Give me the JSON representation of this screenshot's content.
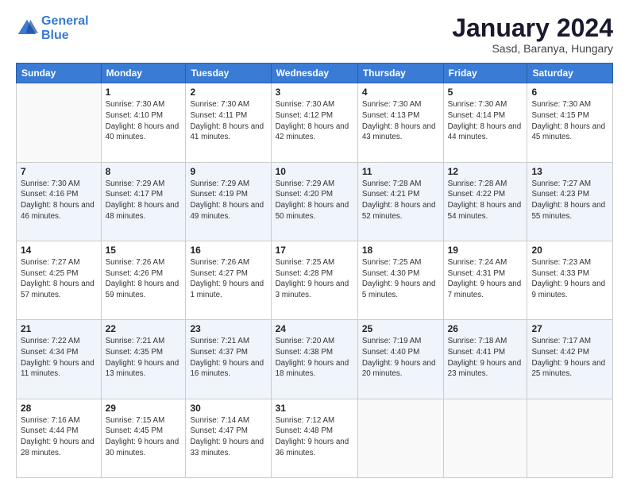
{
  "header": {
    "logo_line1": "General",
    "logo_line2": "Blue",
    "title": "January 2024",
    "subtitle": "Sasd, Baranya, Hungary"
  },
  "days_of_week": [
    "Sunday",
    "Monday",
    "Tuesday",
    "Wednesday",
    "Thursday",
    "Friday",
    "Saturday"
  ],
  "weeks": [
    [
      {
        "num": "",
        "sunrise": "",
        "sunset": "",
        "daylight": ""
      },
      {
        "num": "1",
        "sunrise": "Sunrise: 7:30 AM",
        "sunset": "Sunset: 4:10 PM",
        "daylight": "Daylight: 8 hours and 40 minutes."
      },
      {
        "num": "2",
        "sunrise": "Sunrise: 7:30 AM",
        "sunset": "Sunset: 4:11 PM",
        "daylight": "Daylight: 8 hours and 41 minutes."
      },
      {
        "num": "3",
        "sunrise": "Sunrise: 7:30 AM",
        "sunset": "Sunset: 4:12 PM",
        "daylight": "Daylight: 8 hours and 42 minutes."
      },
      {
        "num": "4",
        "sunrise": "Sunrise: 7:30 AM",
        "sunset": "Sunset: 4:13 PM",
        "daylight": "Daylight: 8 hours and 43 minutes."
      },
      {
        "num": "5",
        "sunrise": "Sunrise: 7:30 AM",
        "sunset": "Sunset: 4:14 PM",
        "daylight": "Daylight: 8 hours and 44 minutes."
      },
      {
        "num": "6",
        "sunrise": "Sunrise: 7:30 AM",
        "sunset": "Sunset: 4:15 PM",
        "daylight": "Daylight: 8 hours and 45 minutes."
      }
    ],
    [
      {
        "num": "7",
        "sunrise": "Sunrise: 7:30 AM",
        "sunset": "Sunset: 4:16 PM",
        "daylight": "Daylight: 8 hours and 46 minutes."
      },
      {
        "num": "8",
        "sunrise": "Sunrise: 7:29 AM",
        "sunset": "Sunset: 4:17 PM",
        "daylight": "Daylight: 8 hours and 48 minutes."
      },
      {
        "num": "9",
        "sunrise": "Sunrise: 7:29 AM",
        "sunset": "Sunset: 4:19 PM",
        "daylight": "Daylight: 8 hours and 49 minutes."
      },
      {
        "num": "10",
        "sunrise": "Sunrise: 7:29 AM",
        "sunset": "Sunset: 4:20 PM",
        "daylight": "Daylight: 8 hours and 50 minutes."
      },
      {
        "num": "11",
        "sunrise": "Sunrise: 7:28 AM",
        "sunset": "Sunset: 4:21 PM",
        "daylight": "Daylight: 8 hours and 52 minutes."
      },
      {
        "num": "12",
        "sunrise": "Sunrise: 7:28 AM",
        "sunset": "Sunset: 4:22 PM",
        "daylight": "Daylight: 8 hours and 54 minutes."
      },
      {
        "num": "13",
        "sunrise": "Sunrise: 7:27 AM",
        "sunset": "Sunset: 4:23 PM",
        "daylight": "Daylight: 8 hours and 55 minutes."
      }
    ],
    [
      {
        "num": "14",
        "sunrise": "Sunrise: 7:27 AM",
        "sunset": "Sunset: 4:25 PM",
        "daylight": "Daylight: 8 hours and 57 minutes."
      },
      {
        "num": "15",
        "sunrise": "Sunrise: 7:26 AM",
        "sunset": "Sunset: 4:26 PM",
        "daylight": "Daylight: 8 hours and 59 minutes."
      },
      {
        "num": "16",
        "sunrise": "Sunrise: 7:26 AM",
        "sunset": "Sunset: 4:27 PM",
        "daylight": "Daylight: 9 hours and 1 minute."
      },
      {
        "num": "17",
        "sunrise": "Sunrise: 7:25 AM",
        "sunset": "Sunset: 4:28 PM",
        "daylight": "Daylight: 9 hours and 3 minutes."
      },
      {
        "num": "18",
        "sunrise": "Sunrise: 7:25 AM",
        "sunset": "Sunset: 4:30 PM",
        "daylight": "Daylight: 9 hours and 5 minutes."
      },
      {
        "num": "19",
        "sunrise": "Sunrise: 7:24 AM",
        "sunset": "Sunset: 4:31 PM",
        "daylight": "Daylight: 9 hours and 7 minutes."
      },
      {
        "num": "20",
        "sunrise": "Sunrise: 7:23 AM",
        "sunset": "Sunset: 4:33 PM",
        "daylight": "Daylight: 9 hours and 9 minutes."
      }
    ],
    [
      {
        "num": "21",
        "sunrise": "Sunrise: 7:22 AM",
        "sunset": "Sunset: 4:34 PM",
        "daylight": "Daylight: 9 hours and 11 minutes."
      },
      {
        "num": "22",
        "sunrise": "Sunrise: 7:21 AM",
        "sunset": "Sunset: 4:35 PM",
        "daylight": "Daylight: 9 hours and 13 minutes."
      },
      {
        "num": "23",
        "sunrise": "Sunrise: 7:21 AM",
        "sunset": "Sunset: 4:37 PM",
        "daylight": "Daylight: 9 hours and 16 minutes."
      },
      {
        "num": "24",
        "sunrise": "Sunrise: 7:20 AM",
        "sunset": "Sunset: 4:38 PM",
        "daylight": "Daylight: 9 hours and 18 minutes."
      },
      {
        "num": "25",
        "sunrise": "Sunrise: 7:19 AM",
        "sunset": "Sunset: 4:40 PM",
        "daylight": "Daylight: 9 hours and 20 minutes."
      },
      {
        "num": "26",
        "sunrise": "Sunrise: 7:18 AM",
        "sunset": "Sunset: 4:41 PM",
        "daylight": "Daylight: 9 hours and 23 minutes."
      },
      {
        "num": "27",
        "sunrise": "Sunrise: 7:17 AM",
        "sunset": "Sunset: 4:42 PM",
        "daylight": "Daylight: 9 hours and 25 minutes."
      }
    ],
    [
      {
        "num": "28",
        "sunrise": "Sunrise: 7:16 AM",
        "sunset": "Sunset: 4:44 PM",
        "daylight": "Daylight: 9 hours and 28 minutes."
      },
      {
        "num": "29",
        "sunrise": "Sunrise: 7:15 AM",
        "sunset": "Sunset: 4:45 PM",
        "daylight": "Daylight: 9 hours and 30 minutes."
      },
      {
        "num": "30",
        "sunrise": "Sunrise: 7:14 AM",
        "sunset": "Sunset: 4:47 PM",
        "daylight": "Daylight: 9 hours and 33 minutes."
      },
      {
        "num": "31",
        "sunrise": "Sunrise: 7:12 AM",
        "sunset": "Sunset: 4:48 PM",
        "daylight": "Daylight: 9 hours and 36 minutes."
      },
      {
        "num": "",
        "sunrise": "",
        "sunset": "",
        "daylight": ""
      },
      {
        "num": "",
        "sunrise": "",
        "sunset": "",
        "daylight": ""
      },
      {
        "num": "",
        "sunrise": "",
        "sunset": "",
        "daylight": ""
      }
    ]
  ]
}
